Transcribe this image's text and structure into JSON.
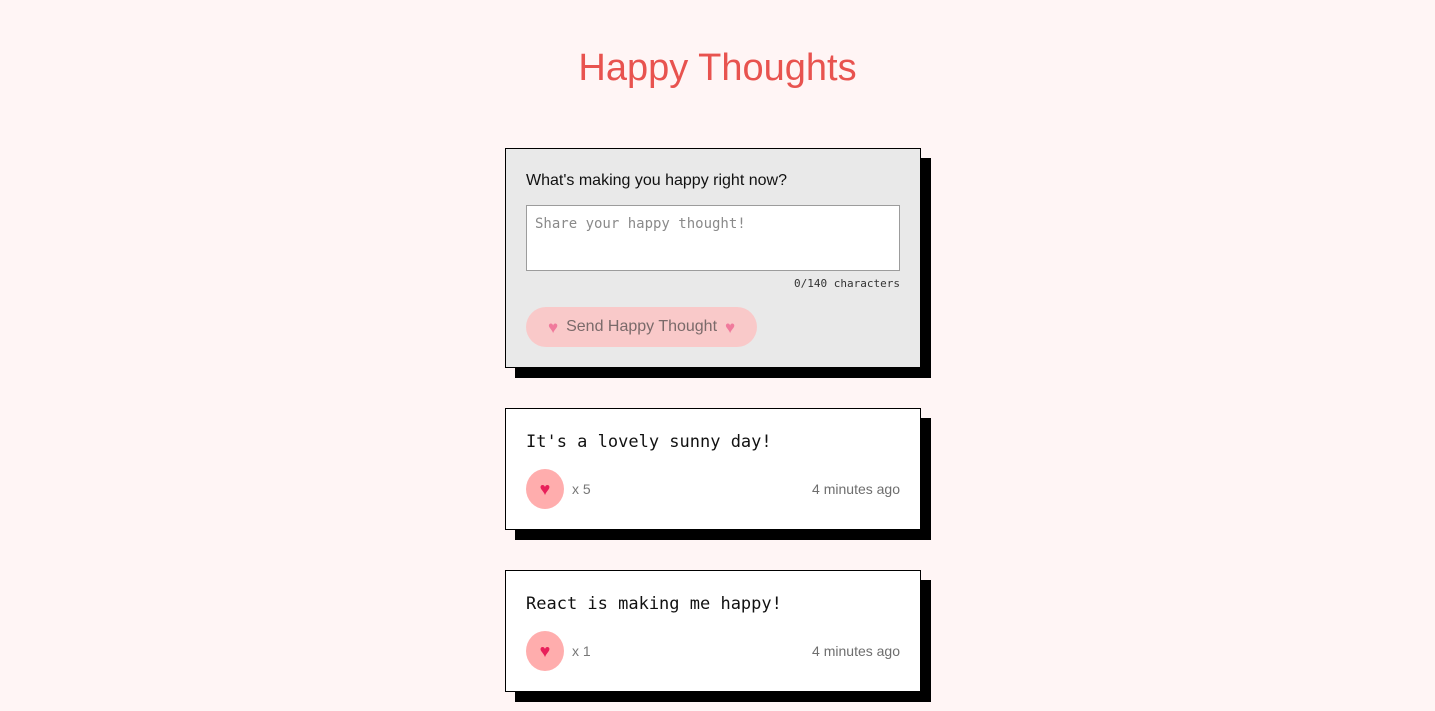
{
  "header": {
    "title": "Happy Thoughts"
  },
  "form": {
    "question": "What's making you happy right now?",
    "placeholder": "Share your happy thought!",
    "value": "",
    "counter": "0/140 characters",
    "send_label": "Send Happy Thought",
    "heart_glyph": "♥"
  },
  "thoughts": [
    {
      "message": "It's a lovely sunny day!",
      "likes": "x 5",
      "time": "4 minutes ago",
      "heart_glyph": "♥"
    },
    {
      "message": "React is making me happy!",
      "likes": "x 1",
      "time": "4 minutes ago",
      "heart_glyph": "♥"
    }
  ],
  "colors": {
    "background": "#fff5f5",
    "title": "#e8534f",
    "form_background": "#e9e9e9",
    "send_button": "#f9c9c9",
    "like_button": "#ffadad",
    "heart": "#e8205a",
    "shadow": "#000000"
  },
  "icons": {
    "send_button_icons": "heart-icon",
    "like_button_icon": "heart-icon"
  }
}
